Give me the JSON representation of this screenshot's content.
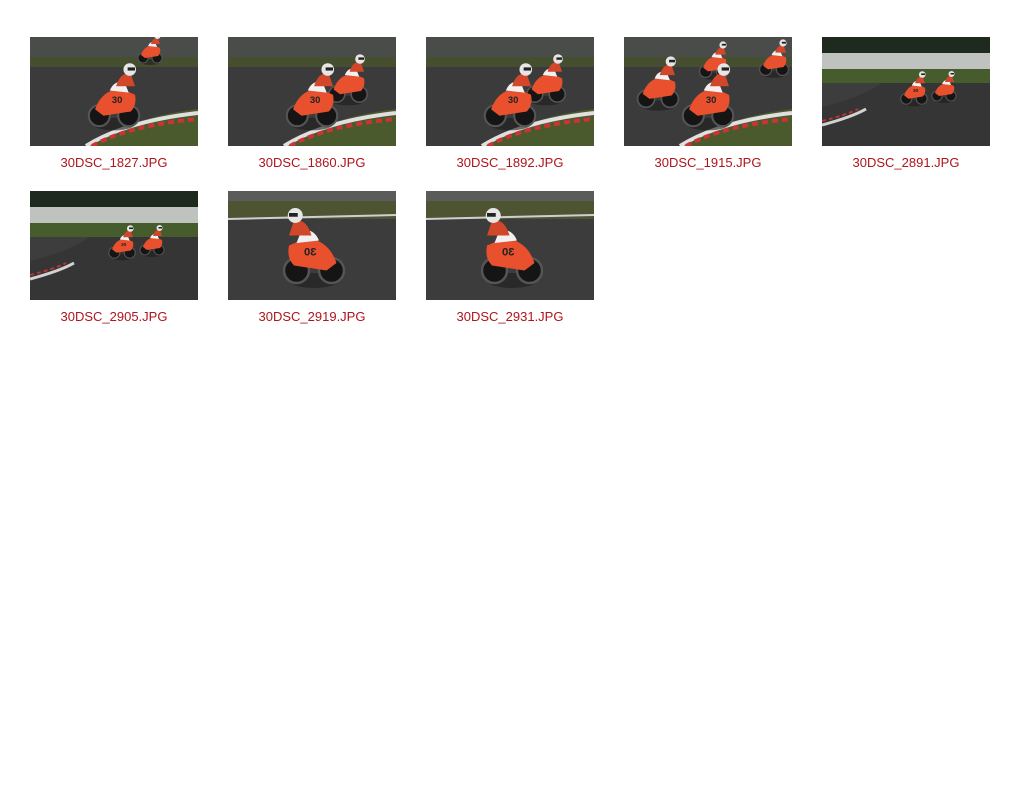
{
  "gallery": {
    "items": [
      {
        "filename": "30DSC_1827.JPG",
        "photo_icon": "motorcycle-racing-photo-icon",
        "variant": "lean-left"
      },
      {
        "filename": "30DSC_1860.JPG",
        "photo_icon": "motorcycle-racing-photo-icon",
        "variant": "lean-left-pair"
      },
      {
        "filename": "30DSC_1892.JPG",
        "photo_icon": "motorcycle-racing-photo-icon",
        "variant": "lean-left-pair"
      },
      {
        "filename": "30DSC_1915.JPG",
        "photo_icon": "motorcycle-racing-photo-icon",
        "variant": "lean-left-group"
      },
      {
        "filename": "30DSC_2891.JPG",
        "photo_icon": "motorcycle-racing-photo-icon",
        "variant": "far-pair"
      },
      {
        "filename": "30DSC_2905.JPG",
        "photo_icon": "motorcycle-racing-photo-icon",
        "variant": "far-pair"
      },
      {
        "filename": "30DSC_2919.JPG",
        "photo_icon": "motorcycle-racing-photo-icon",
        "variant": "side-right"
      },
      {
        "filename": "30DSC_2931.JPG",
        "photo_icon": "motorcycle-racing-photo-icon",
        "variant": "side-right"
      }
    ],
    "bike_number": "30",
    "colors": {
      "caption": "#b0141c",
      "bike_orange": "#e8502e",
      "track": "#3a3b3a",
      "grass": "#4d5a30"
    }
  }
}
